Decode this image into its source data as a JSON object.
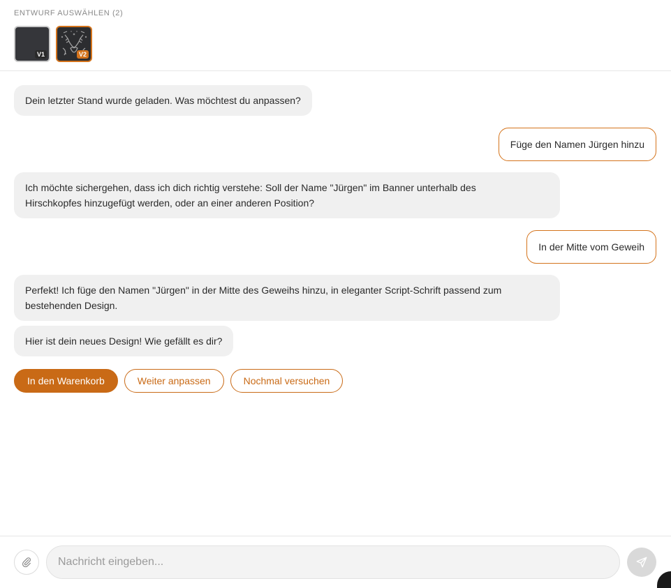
{
  "header": {
    "section_label": "ENTWURF AUSWÄHLEN (2)",
    "drafts": [
      {
        "badge": "V1",
        "selected": false
      },
      {
        "badge": "V2",
        "selected": true
      }
    ]
  },
  "messages": [
    {
      "role": "bot",
      "text": "Dein letzter Stand wurde geladen. Was möchtest du anpassen?"
    },
    {
      "role": "user",
      "text": "Füge den Namen Jürgen hinzu"
    },
    {
      "role": "bot",
      "line1": "Ich möchte sichergehen, dass ich dich richtig verstehe: Soll der Name \"Jürgen\" im Banner unterhalb des",
      "line2": "Hirschkopfes hinzugefügt werden, oder an einer anderen Position?"
    },
    {
      "role": "user",
      "text": "In der Mitte vom Geweih"
    },
    {
      "role": "bot",
      "line1": "Perfekt! Ich füge den Namen \"Jürgen\" in der Mitte des Geweihs hinzu, in eleganter Script-Schrift passend zum",
      "line2": "bestehenden Design."
    },
    {
      "role": "bot",
      "text": "Hier ist dein neues Design! Wie gefällt es dir?"
    }
  ],
  "actions": {
    "add_to_cart": "In den Warenkorb",
    "continue_edit": "Weiter anpassen",
    "retry": "Nochmal versuchen"
  },
  "composer": {
    "placeholder": "Nachricht eingeben...",
    "attach_icon": "paperclip-icon",
    "send_icon": "send-icon"
  },
  "colors": {
    "accent": "#c96a16",
    "bot_bubble": "#f0f0f0",
    "send_disabled": "#d9d9d9"
  }
}
